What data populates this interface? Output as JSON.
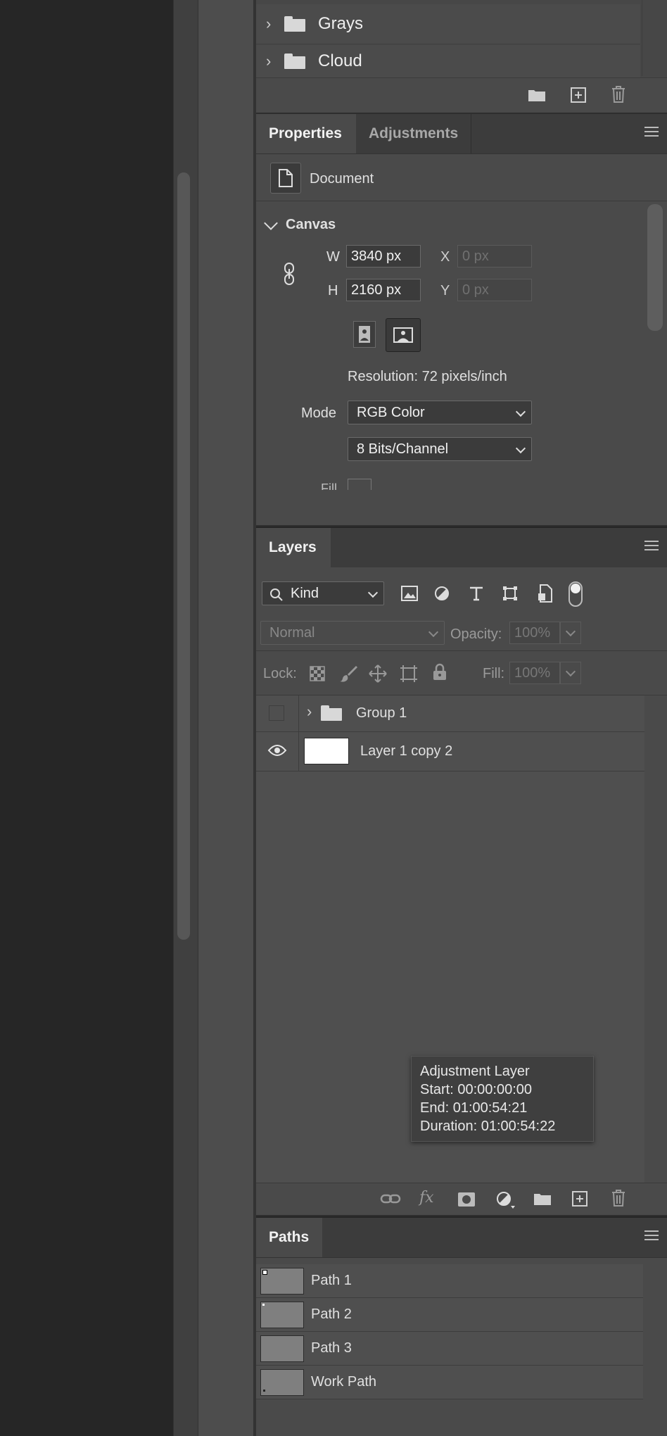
{
  "swatches": {
    "items": [
      {
        "label": "Grays"
      },
      {
        "label": "Cloud"
      }
    ]
  },
  "properties": {
    "tabs": [
      "Properties",
      "Adjustments"
    ],
    "doc_label": "Document",
    "canvas_label": "Canvas",
    "w_label": "W",
    "w_value": "3840 px",
    "h_label": "H",
    "h_value": "2160 px",
    "x_label": "X",
    "x_placeholder": "0 px",
    "y_label": "Y",
    "y_placeholder": "0 px",
    "resolution": "Resolution: 72 pixels/inch",
    "mode_label": "Mode",
    "mode_value": "RGB Color",
    "bits_value": "8 Bits/Channel",
    "fill_label": "Fill"
  },
  "layers": {
    "tab": "Layers",
    "filter_value": "Kind",
    "blend_mode": "Normal",
    "opacity_label": "Opacity:",
    "opacity_value": "100%",
    "lock_label": "Lock:",
    "fill_label": "Fill:",
    "fill_value": "100%",
    "rows": [
      {
        "name": "Group 1"
      },
      {
        "name": "Layer 1 copy 2"
      }
    ],
    "fx_label": "fx"
  },
  "tooltip": {
    "title": "Adjustment Layer",
    "start": "Start: 00:00:00:00",
    "end": "End: 01:00:54:21",
    "duration": "Duration: 01:00:54:22"
  },
  "paths": {
    "tab": "Paths",
    "items": [
      {
        "name": "Path 1"
      },
      {
        "name": "Path 2"
      },
      {
        "name": "Path 3"
      },
      {
        "name": "Work Path"
      }
    ]
  },
  "colors": {
    "panel_bg": "#4a4a4a",
    "tab_bg": "#3c3c3c",
    "dark_bg": "#262626"
  }
}
